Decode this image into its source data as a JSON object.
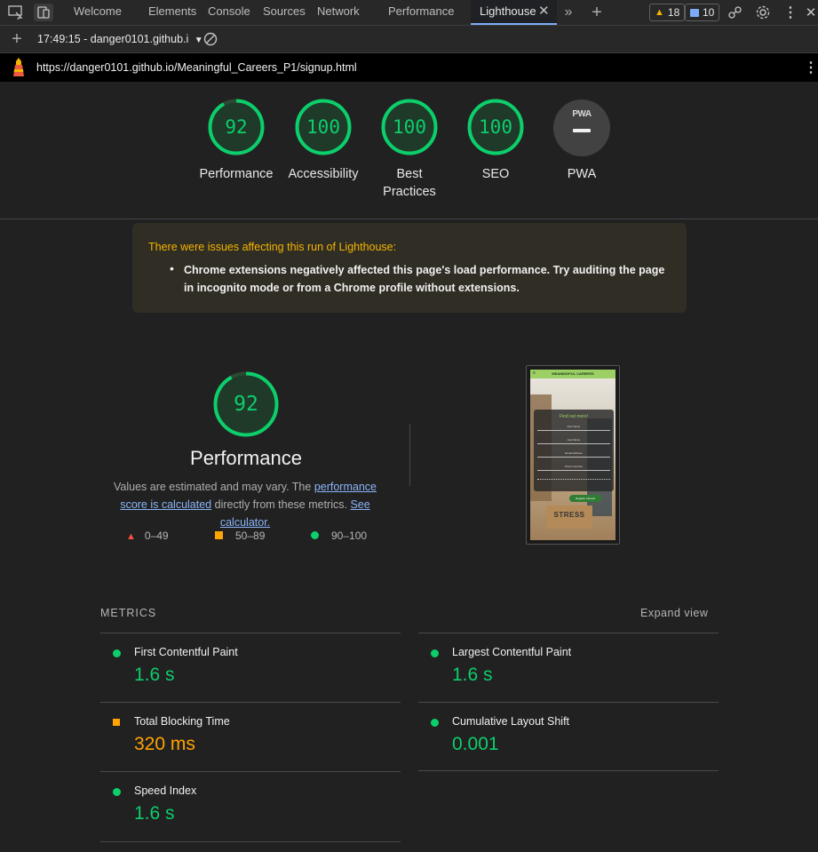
{
  "devtools": {
    "tabs": [
      "Welcome",
      "Elements",
      "Console",
      "Sources",
      "Network",
      "Performance",
      "Lighthouse"
    ],
    "active_tab": "Lighthouse",
    "warnings_count": "18",
    "messages_count": "10"
  },
  "report_bar": {
    "report_select": "17:49:15 - danger0101.github.i"
  },
  "url_bar": {
    "url": "https://danger0101.github.io/Meaningful_Careers_P1/signup.html"
  },
  "scores": [
    {
      "value": "92",
      "label": "Performance"
    },
    {
      "value": "100",
      "label": "Accessibility"
    },
    {
      "value": "100",
      "label": "Best Practices"
    },
    {
      "value": "100",
      "label": "SEO"
    },
    {
      "value": "PWA",
      "label": "PWA"
    }
  ],
  "score_fractions": [
    0.92,
    1,
    1,
    1
  ],
  "warning_box": {
    "title": "There were issues affecting this run of Lighthouse:",
    "item": "Chrome extensions negatively affected this page's load performance. Try auditing the page in incognito mode or from a Chrome profile without extensions."
  },
  "performance": {
    "score": "92",
    "title": "Performance",
    "desc_pre": "Values are estimated and may vary. The ",
    "desc_link1": "performance score is calculated",
    "desc_mid": " directly from these metrics. ",
    "desc_link2": "See calculator.",
    "legend": [
      "0–49",
      "50–89",
      "90–100"
    ]
  },
  "screenshot": {
    "header": "MEANINGFUL CAREERS",
    "card_title": "Find out more!",
    "fields": [
      "First Name",
      "Last Name",
      "Email Address",
      "Phone Number"
    ],
    "button": "Register Interest",
    "box_text": "STRESS"
  },
  "metrics": {
    "title": "METRICS",
    "expand": "Expand view",
    "items": [
      {
        "name": "First Contentful Paint",
        "value": "1.6 s",
        "status": "good"
      },
      {
        "name": "Largest Contentful Paint",
        "value": "1.6 s",
        "status": "good"
      },
      {
        "name": "Total Blocking Time",
        "value": "320 ms",
        "status": "average"
      },
      {
        "name": "Cumulative Layout Shift",
        "value": "0.001",
        "status": "good"
      },
      {
        "name": "Speed Index",
        "value": "1.6 s",
        "status": "good"
      }
    ]
  },
  "colors": {
    "good": "#0cce6b",
    "average": "#ffa400",
    "poor": "#ff4e42",
    "link": "#8ab4f8",
    "warning": "#f4b400"
  }
}
